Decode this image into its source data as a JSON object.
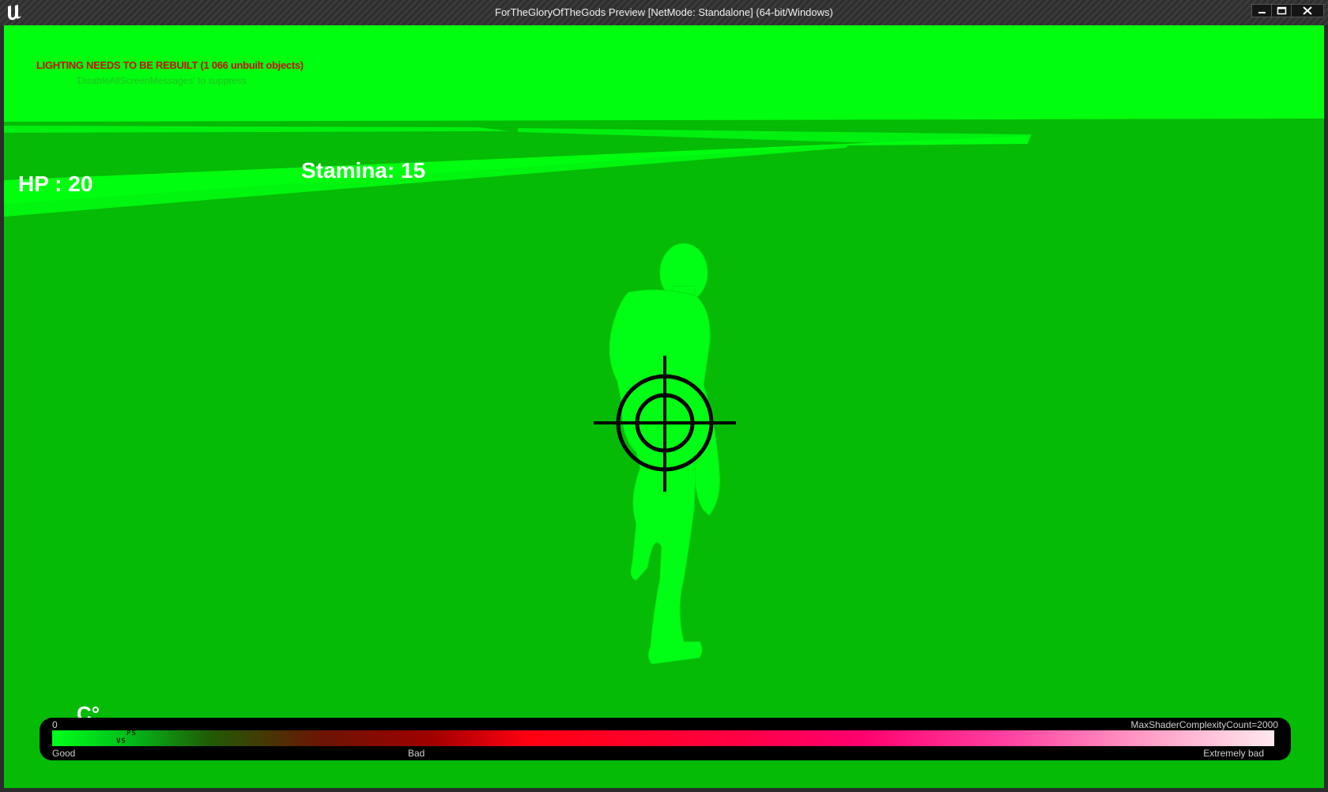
{
  "window": {
    "title": "ForTheGloryOfTheGods Preview [NetMode: Standalone]  (64-bit/Windows)",
    "app_icon": "unreal-engine-logo-icon",
    "controls": {
      "minimize_icon": "minimize-icon",
      "maximize_icon": "maximize-icon",
      "close_icon": "close-icon"
    }
  },
  "viewport": {
    "view_mode": "shader-complexity",
    "background_color": "#05bb05",
    "sky_color": "#00ff0f",
    "messages": {
      "lighting_warning": "LIGHTING NEEDS TO BE REBUILT (1 066 unbuilt objects)",
      "suppress_hint": "'DisableAllScreenMessages' to suppress"
    },
    "hud": {
      "hp_text": "HP :  20",
      "stamina_text": "Stamina: 15",
      "temperature_text": "C°",
      "crosshair_icon": "crosshair-icon"
    },
    "character_icon": "player-character-silhouette"
  },
  "shader_legend": {
    "min_label": "0",
    "max_label": "MaxShaderComplexityCount=2000",
    "good_label": "Good",
    "bad_label": "Bad",
    "extremely_bad_label": "Extremely bad",
    "ps_marker": "PS",
    "vs_marker": "VS"
  }
}
